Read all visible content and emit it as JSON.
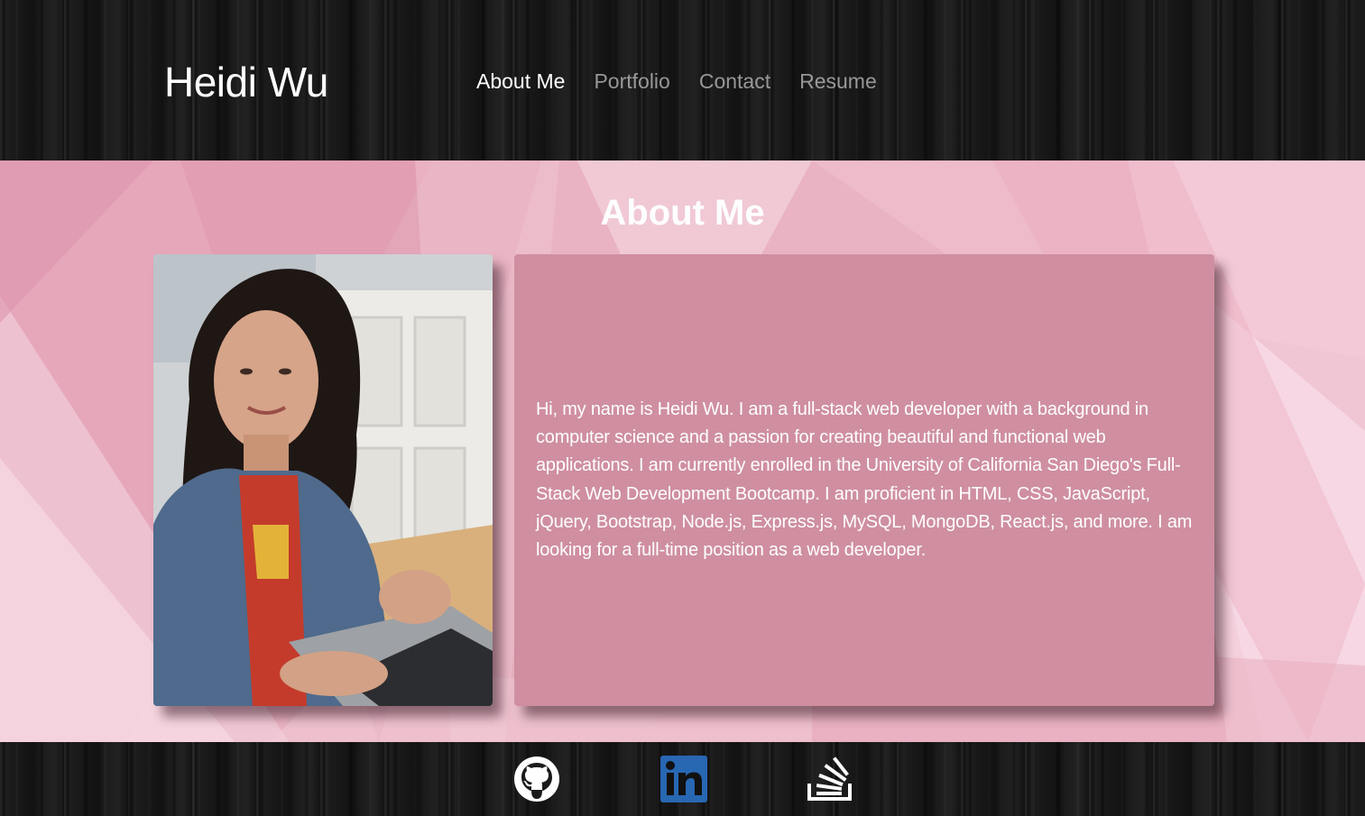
{
  "header": {
    "brand": "Heidi Wu",
    "nav": [
      {
        "label": "About Me",
        "active": true
      },
      {
        "label": "Portfolio",
        "active": false
      },
      {
        "label": "Contact",
        "active": false
      },
      {
        "label": "Resume",
        "active": false
      }
    ]
  },
  "about": {
    "title": "About Me",
    "bio": "Hi, my name is Heidi Wu. I am a full-stack web developer with a background in computer science and a passion for creating beautiful and functional web applications. I am currently enrolled in the University of California San Diego's Full-Stack Web Development Bootcamp. I am proficient in HTML, CSS, JavaScript, jQuery, Bootstrap, Node.js, Express.js, MySQL, MongoDB, React.js, and more. I am looking for a full-time position as a web developer."
  },
  "footer": {
    "links": [
      {
        "icon": "github-icon"
      },
      {
        "icon": "linkedin-icon"
      },
      {
        "icon": "stackoverflow-icon"
      }
    ]
  },
  "colors": {
    "header_bg": "#1b1b1b",
    "section_bg": "#eab6c6",
    "card_bg": "#cf8fa1",
    "nav_active": "#ffffff",
    "nav_inactive": "#9a9a9a",
    "linkedin_blue": "#2867b2"
  }
}
